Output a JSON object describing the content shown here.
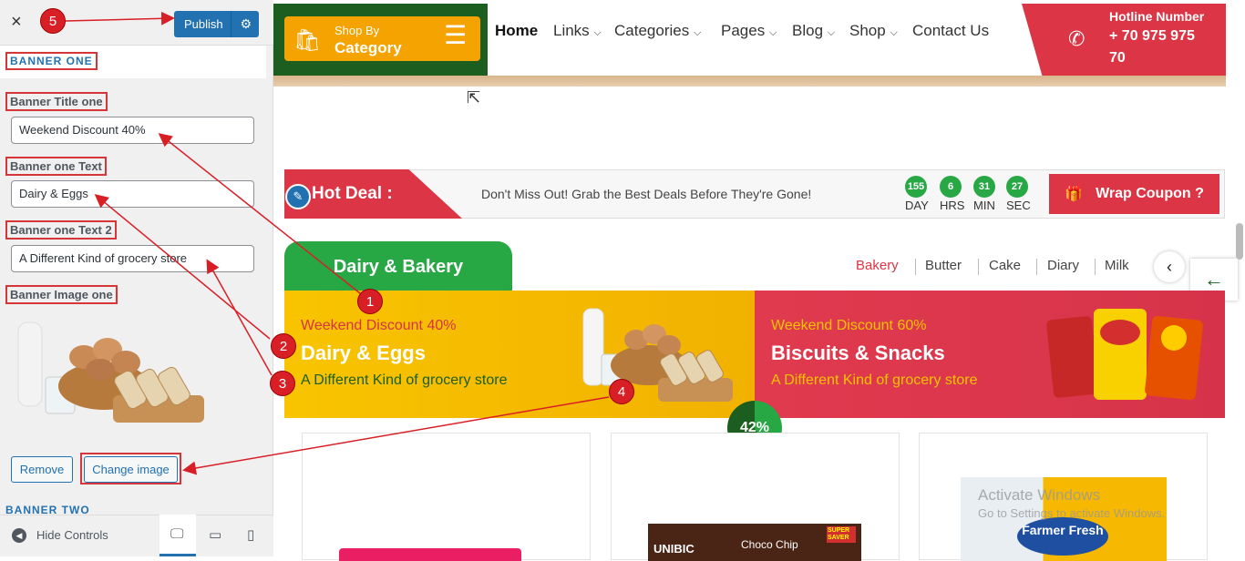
{
  "sidebar": {
    "close_icon": "×",
    "publish_label": "Publish",
    "section_title": "BANNER ONE",
    "fields": [
      {
        "label": "Banner Title one",
        "value": "Weekend Discount 40%"
      },
      {
        "label": "Banner one Text",
        "value": "Dairy & Eggs"
      },
      {
        "label": "Banner one Text 2",
        "value": "A Different Kind of grocery store"
      }
    ],
    "image_label": "Banner Image one",
    "remove_label": "Remove",
    "change_label": "Change image",
    "next_section": "BANNER TWO",
    "hide_controls": "Hide Controls"
  },
  "header": {
    "shop_by_line1": "Shop By",
    "shop_by_line2": "Category",
    "nav": [
      "Home",
      "Links",
      "Categories",
      "Pages",
      "Blog",
      "Shop",
      "Contact Us"
    ],
    "hotline_title": "Hotline Number",
    "hotline_number_line1": "+ 70 975 975",
    "hotline_number_line2": "70"
  },
  "hot_deal": {
    "label": "Hot Deal :",
    "text": "Don't Miss Out! Grab the Best Deals Before They're Gone!",
    "countdown": [
      {
        "num": "155",
        "unit": "DAY"
      },
      {
        "num": "6",
        "unit": "HRS"
      },
      {
        "num": "31",
        "unit": "MIN"
      },
      {
        "num": "27",
        "unit": "SEC"
      }
    ],
    "coupon_label": "Wrap Coupon ?"
  },
  "category_section": {
    "title": "Dairy & Bakery",
    "tabs": [
      "Bakery",
      "Butter",
      "Cake",
      "Diary",
      "Milk"
    ],
    "active_tab": "Bakery"
  },
  "banners": [
    {
      "title": "Weekend Discount 40%",
      "main": "Dairy & Eggs",
      "sub": "A Different Kind of grocery store"
    },
    {
      "title": "Weekend Discount 60%",
      "main": "Biscuits & Snacks",
      "sub": "A Different Kind of grocery store"
    }
  ],
  "percent_badge": "42%",
  "products": {
    "chip_brand": "UNIBIC",
    "chip_name": "Choco Chip",
    "saver": "SUPER SAVER",
    "fresh_brand": "Farmer Fresh"
  },
  "watermark": {
    "line1": "Activate Windows",
    "line2": "Go to Settings to activate Windows."
  },
  "annotations": [
    "1",
    "2",
    "3",
    "4",
    "5"
  ],
  "colors": {
    "accent": "#2271b1",
    "red": "#dc3545",
    "green": "#28a745",
    "dark_green": "#1b5e20",
    "orange": "#f5a300"
  }
}
